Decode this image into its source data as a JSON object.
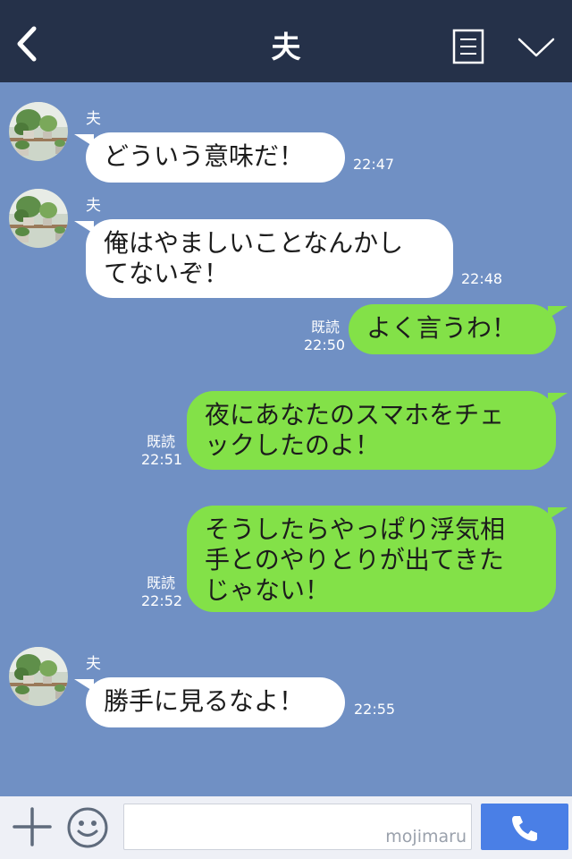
{
  "header": {
    "title": "夫",
    "back_icon": "chevron-left-icon",
    "memo_icon": "note-icon",
    "menu_icon": "chevron-down-icon"
  },
  "messages": [
    {
      "side": "in",
      "sender": "夫",
      "text": "どういう意味だ！",
      "time": "22:47"
    },
    {
      "side": "in",
      "sender": "夫",
      "text": "俺はやましいことなんかし\nてないぞ！",
      "time": "22:48"
    },
    {
      "side": "out",
      "read": "既読",
      "text": "よく言うわ！",
      "time": "22:50"
    },
    {
      "side": "out",
      "read": "既読",
      "text": "夜にあなたのスマホをチェ\nックしたのよ！",
      "time": "22:51"
    },
    {
      "side": "out",
      "read": "既読",
      "text": "そうしたらやっぱり浮気相\n手とのやりとりが出てきた\nじゃない！",
      "time": "22:52"
    },
    {
      "side": "in",
      "sender": "夫",
      "text": "勝手に見るなよ！",
      "time": "22:55"
    }
  ],
  "footer": {
    "plus_icon": "plus-icon",
    "emoji_icon": "smiley-icon",
    "input_value": "",
    "call_icon": "phone-icon",
    "watermark": "mojimaru"
  },
  "colors": {
    "header_bg": "#253149",
    "chat_bg": "#7090c4",
    "incoming_bubble": "#ffffff",
    "outgoing_bubble": "#83e148",
    "call_button": "#4a7fe6"
  }
}
